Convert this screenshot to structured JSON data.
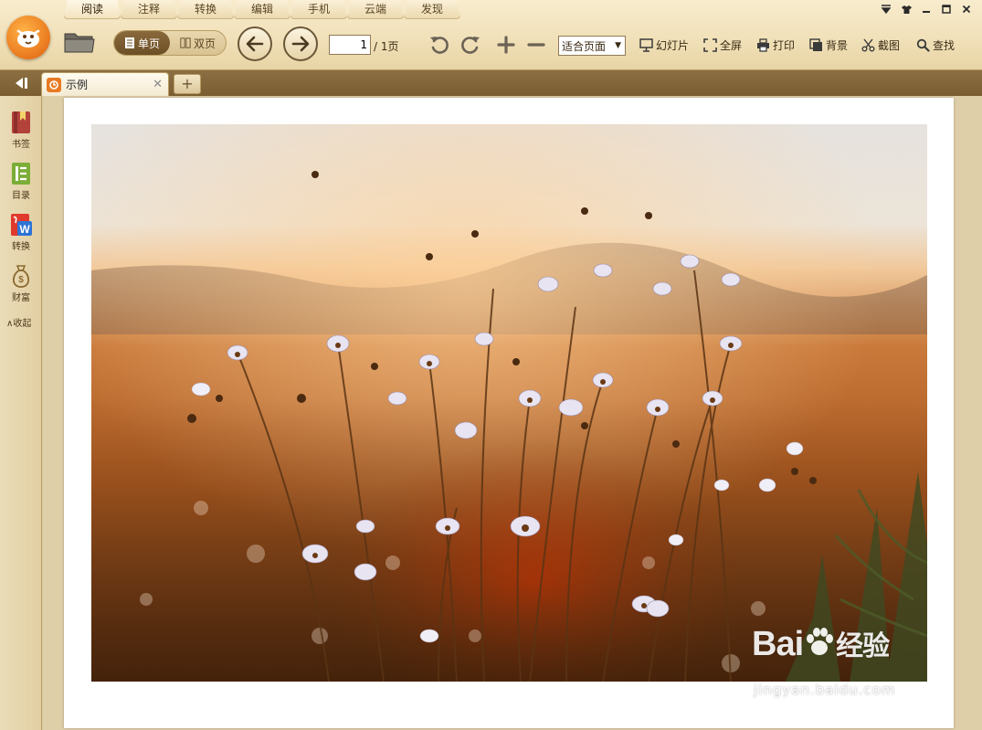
{
  "menu": {
    "tabs": [
      "阅读",
      "注释",
      "转换",
      "编辑",
      "手机",
      "云端",
      "发现"
    ],
    "active_index": 0
  },
  "window_controls": [
    "menu-icon",
    "skin-icon",
    "minimize-icon",
    "maximize-icon",
    "close-icon"
  ],
  "toolbar": {
    "single_page_label": "单页",
    "double_page_label": "双页",
    "current_page": "1",
    "page_total": "/ 1页",
    "zoom_mode": "适合页面",
    "slideshow_label": "幻灯片",
    "fullscreen_label": "全屏",
    "print_label": "打印",
    "background_label": "背景",
    "screenshot_label": "截图",
    "search_label": "查找"
  },
  "tabs": {
    "document_name": "示例",
    "new_tab_symbol": "+"
  },
  "sidebar": {
    "items": [
      {
        "label": "书签",
        "icon": "bookmark-icon"
      },
      {
        "label": "目录",
        "icon": "toc-icon"
      },
      {
        "label": "转换",
        "icon": "pdf-to-word-icon"
      },
      {
        "label": "财富",
        "icon": "money-bag-icon"
      }
    ],
    "collapse_label": "∧收起"
  },
  "watermark": {
    "brand": "Bai",
    "brand_tail": "经验",
    "url": "jingyan.baidu.com"
  },
  "colors": {
    "chrome": "#f1e1b9",
    "tabbar": "#7a5d31",
    "accent": "#e9781e"
  }
}
